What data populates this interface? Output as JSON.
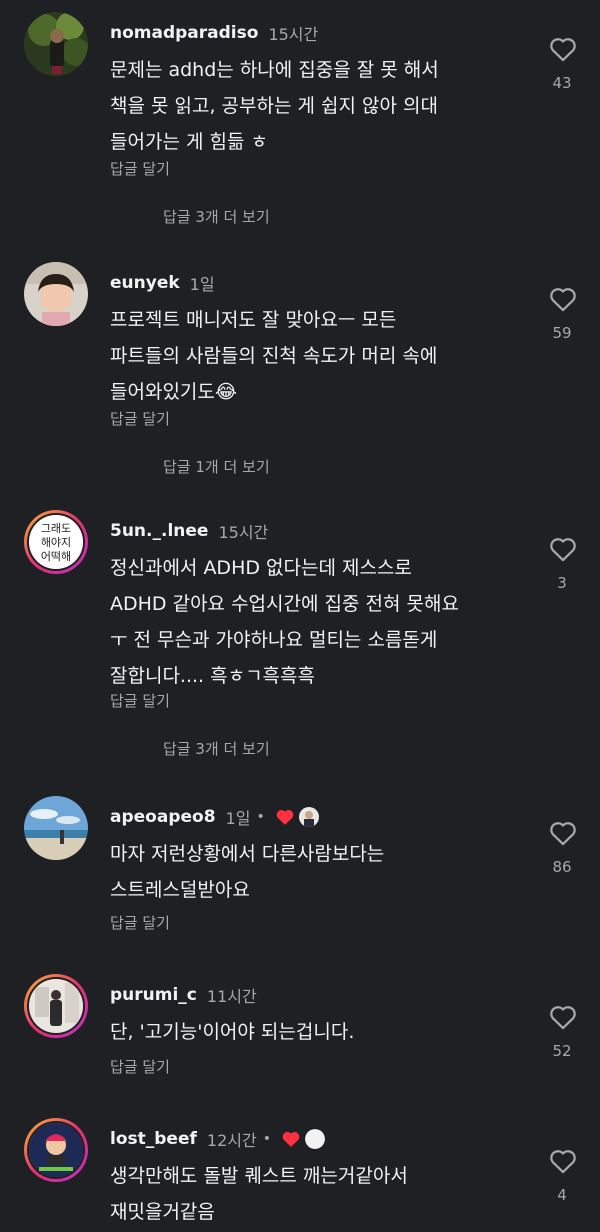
{
  "comments": [
    {
      "username": "nomadparadiso",
      "time": "15시간",
      "text": "문제는 adhd는 하나에 집중을 잘 못 해서\n책을 못 읽고, 공부하는 게 쉽지 않아 의대\n들어가는 게 힘듦 ㅎ",
      "reply_label": "답글 달기",
      "view_replies": "답글 3개 더 보기",
      "likes": "43"
    },
    {
      "username": "eunyek",
      "time": "1일",
      "text": "프로젝트 매니저도 잘 맞아요ㅡ 모든\n파트들의 사람들의 진척 속도가 머리 속에\n들어와있기도😂",
      "reply_label": "답글 달기",
      "view_replies": "답글 1개 더 보기",
      "likes": "59"
    },
    {
      "username": "5un._.lnee",
      "time": "15시간",
      "text": "정신과에서 ADHD 없다는데 제스스로\nADHD 같아요 수업시간에 집중 전혀 못해요\nㅜ 전 무슨과 가야하나요 멀티는 소름돋게\n잘합니다.... 흑ㅎㄱ흑흑흑",
      "reply_label": "답글 달기",
      "view_replies": "답글 3개 더 보기",
      "likes": "3",
      "avatar_text": [
        "그래도",
        "해야지",
        "어떡해"
      ]
    },
    {
      "username": "apeoapeo8",
      "time": "1일",
      "dot": "•",
      "text": "마자 저런상황에서 다른사람보다는\n스트레스덜받아요",
      "reply_label": "답글 달기",
      "likes": "86"
    },
    {
      "username": "purumi_c",
      "time": "11시간",
      "text": "단, '고기능'이어야 되는겁니다.",
      "reply_label": "답글 달기",
      "likes": "52"
    },
    {
      "username": "lost_beef",
      "time": "12시간",
      "dot": "•",
      "text": "생각만해도 돌발 퀘스트 깨는거같아서\n재밋을거같음",
      "likes": "4"
    }
  ],
  "icons": {
    "like": "heart-outline-icon",
    "creator_like": "heart-filled-icon"
  },
  "colors": {
    "background": "#1f2024",
    "primary_text": "#f2f2f2",
    "secondary_text": "#a8a8a8",
    "creator_heart": "#ff3040"
  }
}
